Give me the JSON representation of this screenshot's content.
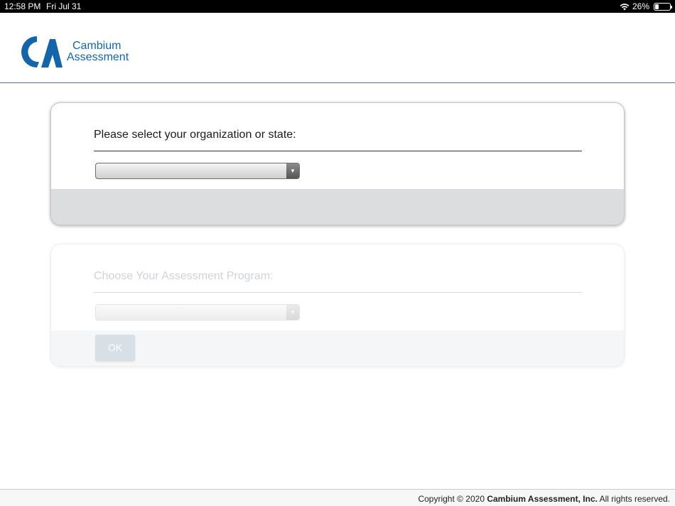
{
  "status_bar": {
    "time": "12:58 PM",
    "date": "Fri Jul 31",
    "battery": "26%"
  },
  "header": {
    "logo_line1": "Cambium",
    "logo_line2": "Assessment",
    "brand_color": "#1565a8"
  },
  "org_panel": {
    "label": "Please select your organization or state:",
    "selected_value": ""
  },
  "program_panel": {
    "label": "Choose Your Assessment Program:",
    "selected_value": "",
    "ok_label": "OK",
    "disabled": true
  },
  "footer": {
    "copyright_prefix": "Copyright © 2020 ",
    "company": "Cambium Assessment, Inc.",
    "copyright_suffix": " All rights reserved."
  }
}
